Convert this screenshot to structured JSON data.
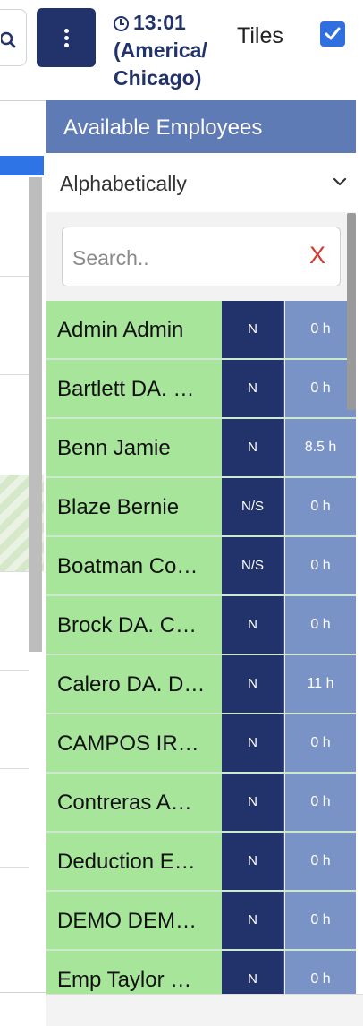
{
  "topbar": {
    "time": "13:01",
    "timezone_line1": "(America/",
    "timezone_line2": "Chicago)",
    "tiles_label": "Tiles",
    "tiles_checked": true
  },
  "panel": {
    "title": "Available Employees",
    "sort_value": "Alphabetically",
    "search_placeholder": "Search..",
    "search_clear": "X",
    "employees": [
      {
        "name": "Admin Admin",
        "status": "N",
        "hours": "0 h"
      },
      {
        "name": "Bartlett DA. …",
        "status": "N",
        "hours": "0 h"
      },
      {
        "name": "Benn Jamie",
        "status": "N",
        "hours": "8.5 h"
      },
      {
        "name": "Blaze Bernie",
        "status": "N/S",
        "hours": "0 h"
      },
      {
        "name": "Boatman Co…",
        "status": "N/S",
        "hours": "0 h"
      },
      {
        "name": "Brock DA. C…",
        "status": "N",
        "hours": "0 h"
      },
      {
        "name": "Calero DA. D…",
        "status": "N",
        "hours": "11 h"
      },
      {
        "name": "CAMPOS IR…",
        "status": "N",
        "hours": "0 h"
      },
      {
        "name": "Contreras A…",
        "status": "N",
        "hours": "0 h"
      },
      {
        "name": "Deduction E…",
        "status": "N",
        "hours": "0 h"
      },
      {
        "name": "DEMO DEM…",
        "status": "N",
        "hours": "0 h"
      },
      {
        "name": "Emp Taylor …",
        "status": "N",
        "hours": "0 h"
      }
    ]
  },
  "colors": {
    "navy": "#22336b",
    "header_blue": "#5f7bb5",
    "hours_blue": "#7a93c6",
    "available_green": "#a6e59a",
    "clear_red": "#d33a2c"
  }
}
